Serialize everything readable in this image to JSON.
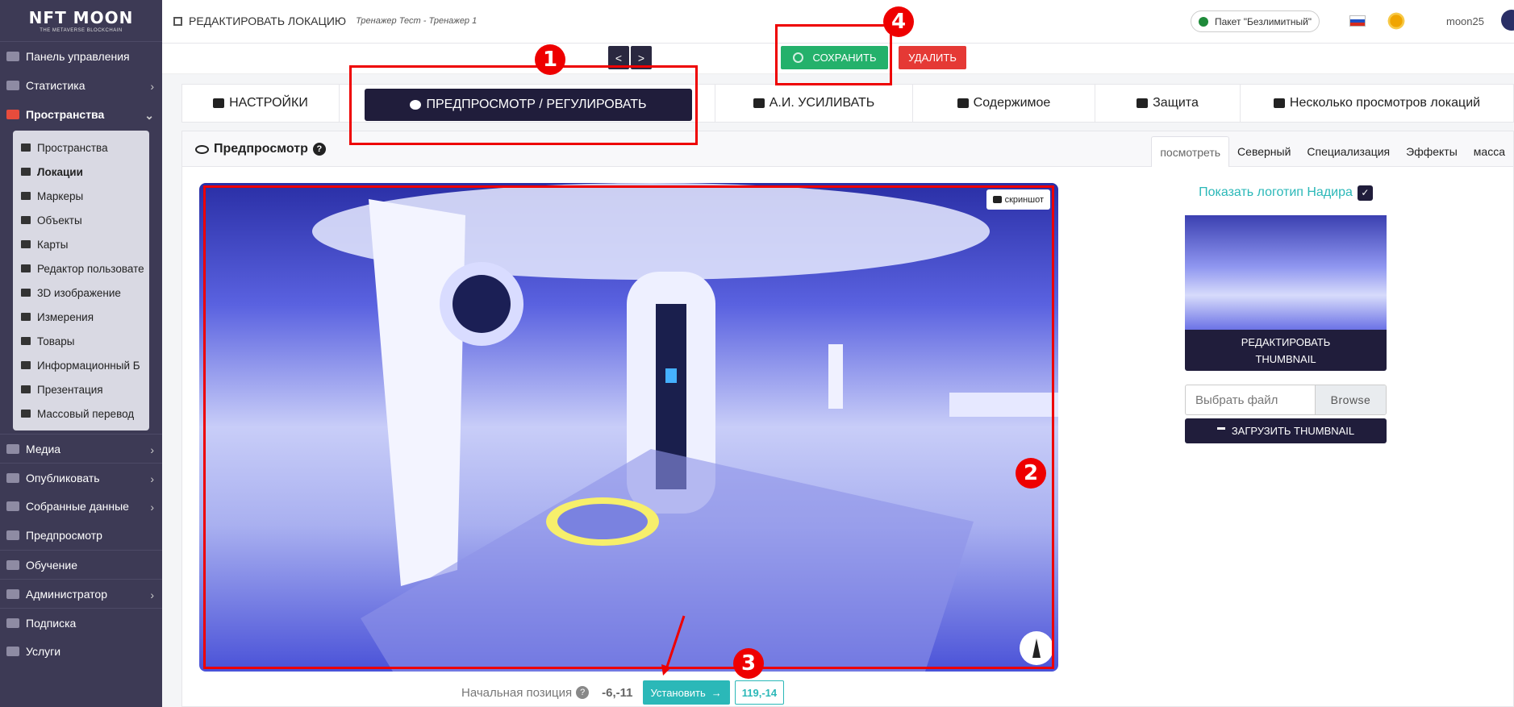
{
  "logo": {
    "title": "NFT MOON",
    "subtitle": "THE METAVERSE BLOCKCHAIN"
  },
  "sidebar": {
    "items": [
      {
        "label": "Панель управления",
        "chevron": false
      },
      {
        "label": "Статистика",
        "chevron": true
      },
      {
        "label": "Пространства",
        "chevron": true,
        "active": true
      }
    ],
    "submenu": [
      {
        "label": "Пространства"
      },
      {
        "label": "Локации",
        "active": true
      },
      {
        "label": "Маркеры"
      },
      {
        "label": "Объекты"
      },
      {
        "label": "Карты"
      },
      {
        "label": "Редактор пользовате"
      },
      {
        "label": "3D изображение"
      },
      {
        "label": "Измерения"
      },
      {
        "label": "Товары"
      },
      {
        "label": "Информационный Б"
      },
      {
        "label": "Презентация"
      },
      {
        "label": "Массовый перевод"
      }
    ],
    "bottom_items": [
      {
        "label": "Медиа",
        "chevron": true
      },
      {
        "label": "Опубликовать",
        "chevron": true
      },
      {
        "label": "Собранные данные",
        "chevron": true
      },
      {
        "label": "Предпросмотр",
        "chevron": false
      },
      {
        "label": "Обучение",
        "chevron": false
      },
      {
        "label": "Администратор",
        "chevron": true
      },
      {
        "label": "Подписка",
        "chevron": false
      },
      {
        "label": "Услуги",
        "chevron": false
      }
    ]
  },
  "topbar": {
    "title": "РЕДАКТИРОВАТЬ ЛОКАЦИЮ",
    "subtitle": "Тренажер Тест - Тренажер 1",
    "package": "Пакет \"Безлимитный\"",
    "username": "moon25"
  },
  "actions": {
    "prev": "<",
    "next": ">",
    "save": "СОХРАНИТЬ",
    "delete": "УДАЛИТЬ"
  },
  "tabs": [
    {
      "label": "НАСТРОЙКИ"
    },
    {
      "label": "ПРЕДПРОСМОТР / РЕГУЛИРОВАТЬ",
      "active": true
    },
    {
      "label": "А.И. УСИЛИВАТЬ"
    },
    {
      "label": "Содержимое"
    },
    {
      "label": "Защита"
    },
    {
      "label": "Несколько просмотров локаций"
    }
  ],
  "panel": {
    "title": "Предпросмотр",
    "subtabs": [
      "посмотреть",
      "Северный",
      "Специализация",
      "Эффекты",
      "масса"
    ]
  },
  "viewer": {
    "screenshot_label": "скриншот"
  },
  "position": {
    "label": "Начальная позиция",
    "value": "-6,-11",
    "set_label": "Установить",
    "coord": "119,-14"
  },
  "side": {
    "logo_toggle": "Показать логотип Надира",
    "edit_thumb_line1": "РЕДАКТИРОВАТЬ",
    "edit_thumb_line2": "THUMBNAIL",
    "file_placeholder": "Выбрать файл",
    "browse": "Browse",
    "upload": "ЗАГРУЗИТЬ THUMBNAIL"
  },
  "annotations": [
    "1",
    "2",
    "3",
    "4"
  ],
  "colors": {
    "sidebar": "#3d3a55",
    "dark_button": "#201d3b",
    "save": "#24b16b",
    "delete": "#e53935",
    "accent": "#2bb8b8",
    "annotation": "#e00000"
  }
}
